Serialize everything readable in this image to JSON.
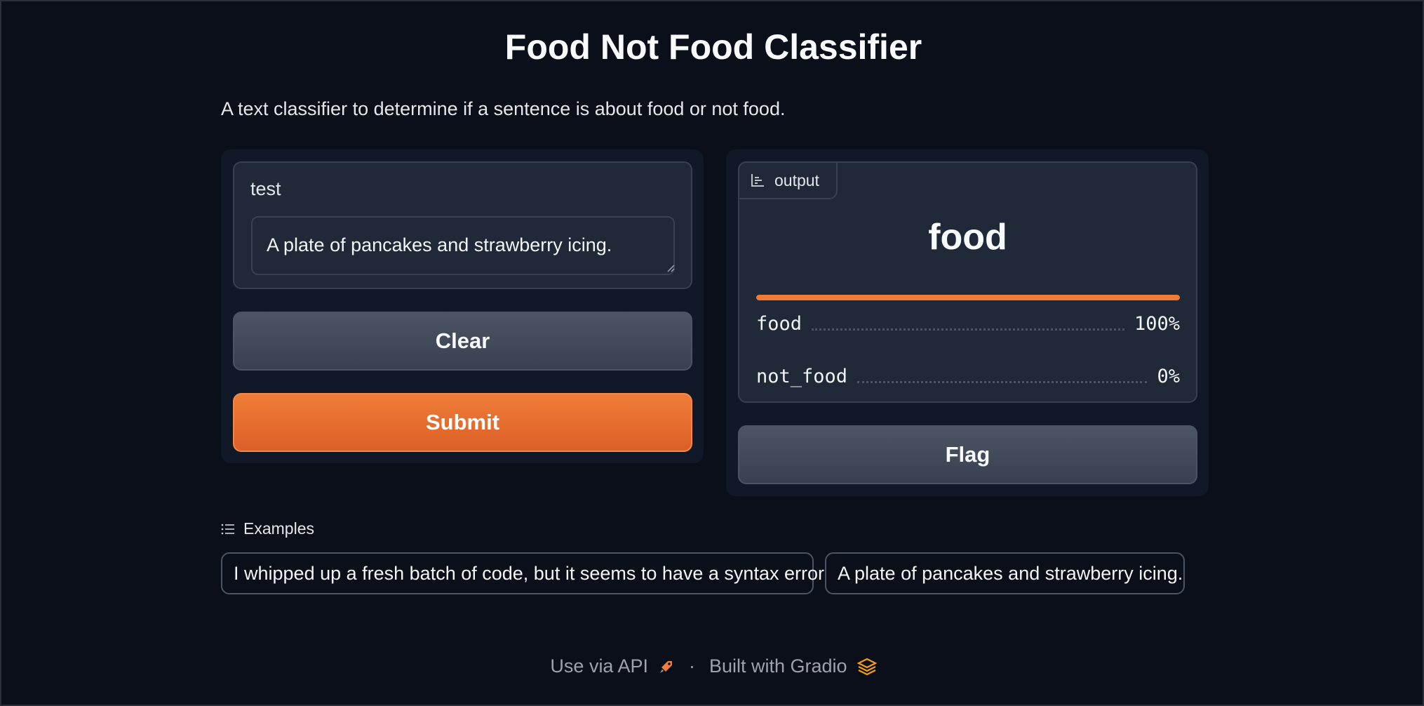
{
  "header": {
    "title": "Food Not Food Classifier",
    "description": "A text classifier to determine if a sentence is about food or not food."
  },
  "input": {
    "label": "test",
    "value": "A plate of pancakes and strawberry icing."
  },
  "buttons": {
    "clear": "Clear",
    "submit": "Submit",
    "flag": "Flag"
  },
  "output": {
    "tag": "output",
    "predicted_label": "food",
    "top_confidence": 1.0,
    "confidences": [
      {
        "label": "food",
        "value": "100%"
      },
      {
        "label": "not_food",
        "value": "0%"
      }
    ]
  },
  "examples": {
    "header": "Examples",
    "items": [
      "I whipped up a fresh batch of code, but it seems to have a syntax error",
      "A plate of pancakes and strawberry icing."
    ]
  },
  "footer": {
    "api_link": "Use via API",
    "separator": "·",
    "built_with": "Built with Gradio"
  },
  "colors": {
    "background": "#0b0f19",
    "panel": "#111827",
    "accent": "#ef7d38"
  },
  "icons": {
    "output_tag": "bar-chart-icon",
    "examples": "list-icon",
    "api": "rocket-icon",
    "gradio": "gradio-logo-icon"
  }
}
